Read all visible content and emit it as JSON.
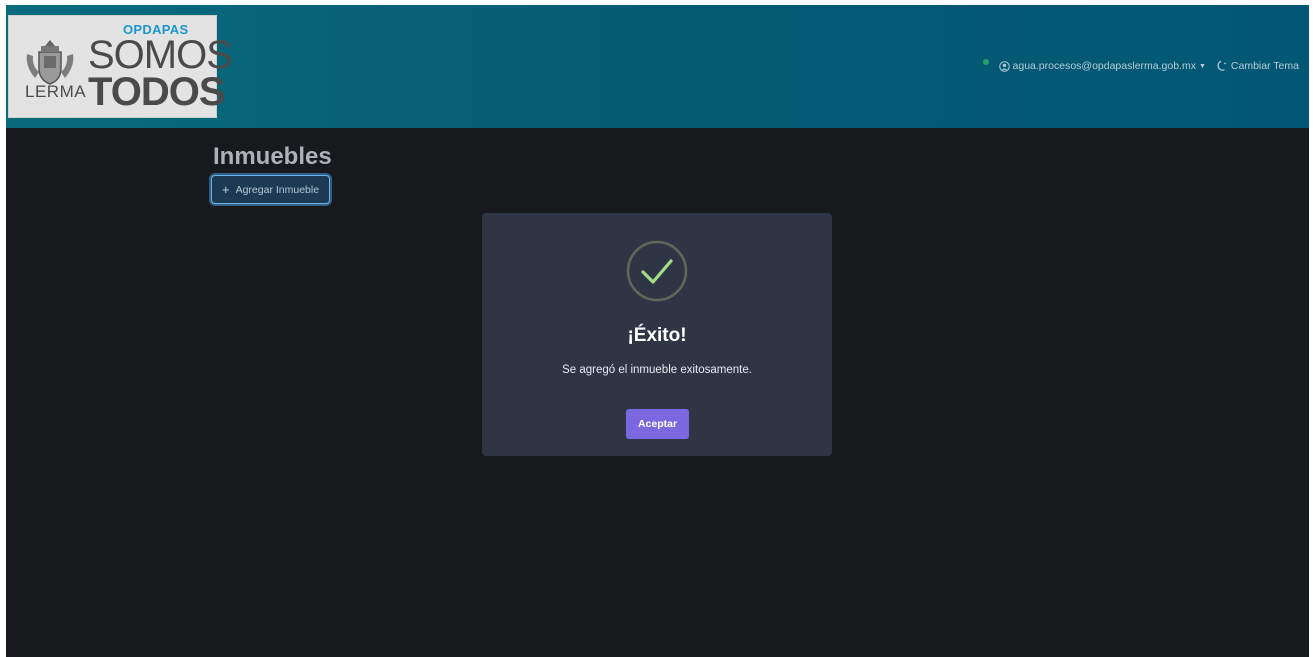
{
  "header": {
    "logo": {
      "org": "OPDAPAS",
      "slogan_line1": "SOMOS",
      "slogan_line2": "TODOS",
      "city": "LERMA"
    },
    "user_email": "agua.procesos@opdapaslerma.gob.mx",
    "theme_label": "Cambiar Tema"
  },
  "main": {
    "title": "Inmuebles",
    "add_button_label": "Agregar Inmueble"
  },
  "modal": {
    "title": "¡Éxito!",
    "message": "Se agregó el inmueble exitosamente.",
    "confirm_label": "Aceptar"
  },
  "colors": {
    "header_bg": "#045a73",
    "page_bg": "#18191d",
    "modal_bg": "#2e3646",
    "success": "#a5dc86",
    "confirm_button": "#7b67e0"
  }
}
